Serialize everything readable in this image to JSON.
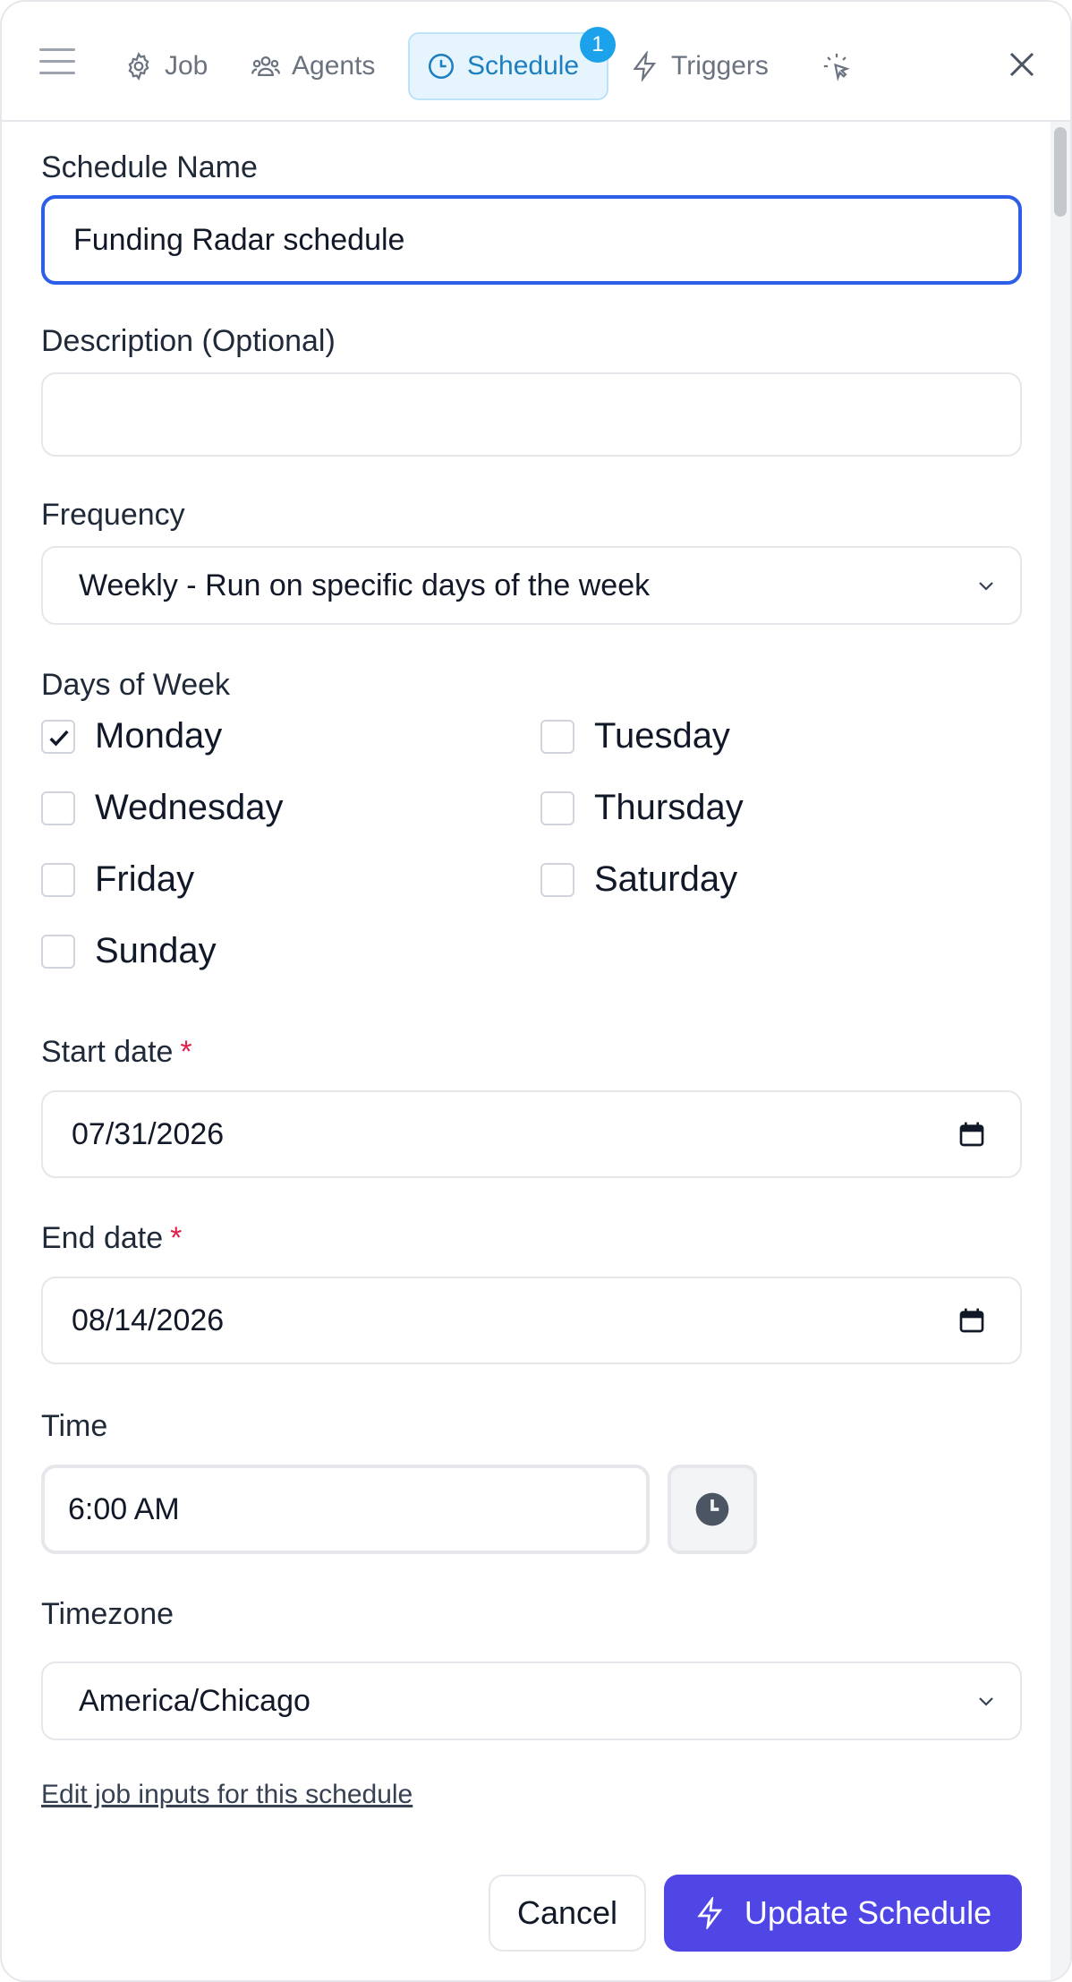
{
  "header": {
    "tabs": [
      {
        "label": "Job",
        "icon": "gear-icon"
      },
      {
        "label": "Agents",
        "icon": "users-icon"
      },
      {
        "label": "Schedule",
        "icon": "clock-icon",
        "badge": "1",
        "active": true
      },
      {
        "label": "Triggers",
        "icon": "lightning-icon"
      }
    ]
  },
  "form": {
    "schedule_name_label": "Schedule Name",
    "schedule_name_value": "Funding Radar schedule",
    "description_label": "Description (Optional)",
    "description_value": "",
    "frequency_label": "Frequency",
    "frequency_value": "Weekly - Run on specific days of the week",
    "days_label": "Days of Week",
    "days": [
      {
        "label": "Monday",
        "checked": true
      },
      {
        "label": "Tuesday",
        "checked": false
      },
      {
        "label": "Wednesday",
        "checked": false
      },
      {
        "label": "Thursday",
        "checked": false
      },
      {
        "label": "Friday",
        "checked": false
      },
      {
        "label": "Saturday",
        "checked": false
      },
      {
        "label": "Sunday",
        "checked": false
      }
    ],
    "start_date_label": "Start date",
    "start_date_value": "07/31/2026",
    "end_date_label": "End date",
    "end_date_value": "08/14/2026",
    "required_mark": "*",
    "time_label": "Time",
    "time_value": "6:00 AM",
    "timezone_label": "Timezone",
    "timezone_value": "America/Chicago",
    "edit_inputs_link": "Edit job inputs for this schedule"
  },
  "footer": {
    "cancel_label": "Cancel",
    "submit_label": "Update Schedule"
  },
  "colors": {
    "accent": "#4f46e5",
    "focus": "#2c5ee8",
    "active_tab": "#1c7fc0",
    "badge": "#1ba2ea"
  }
}
